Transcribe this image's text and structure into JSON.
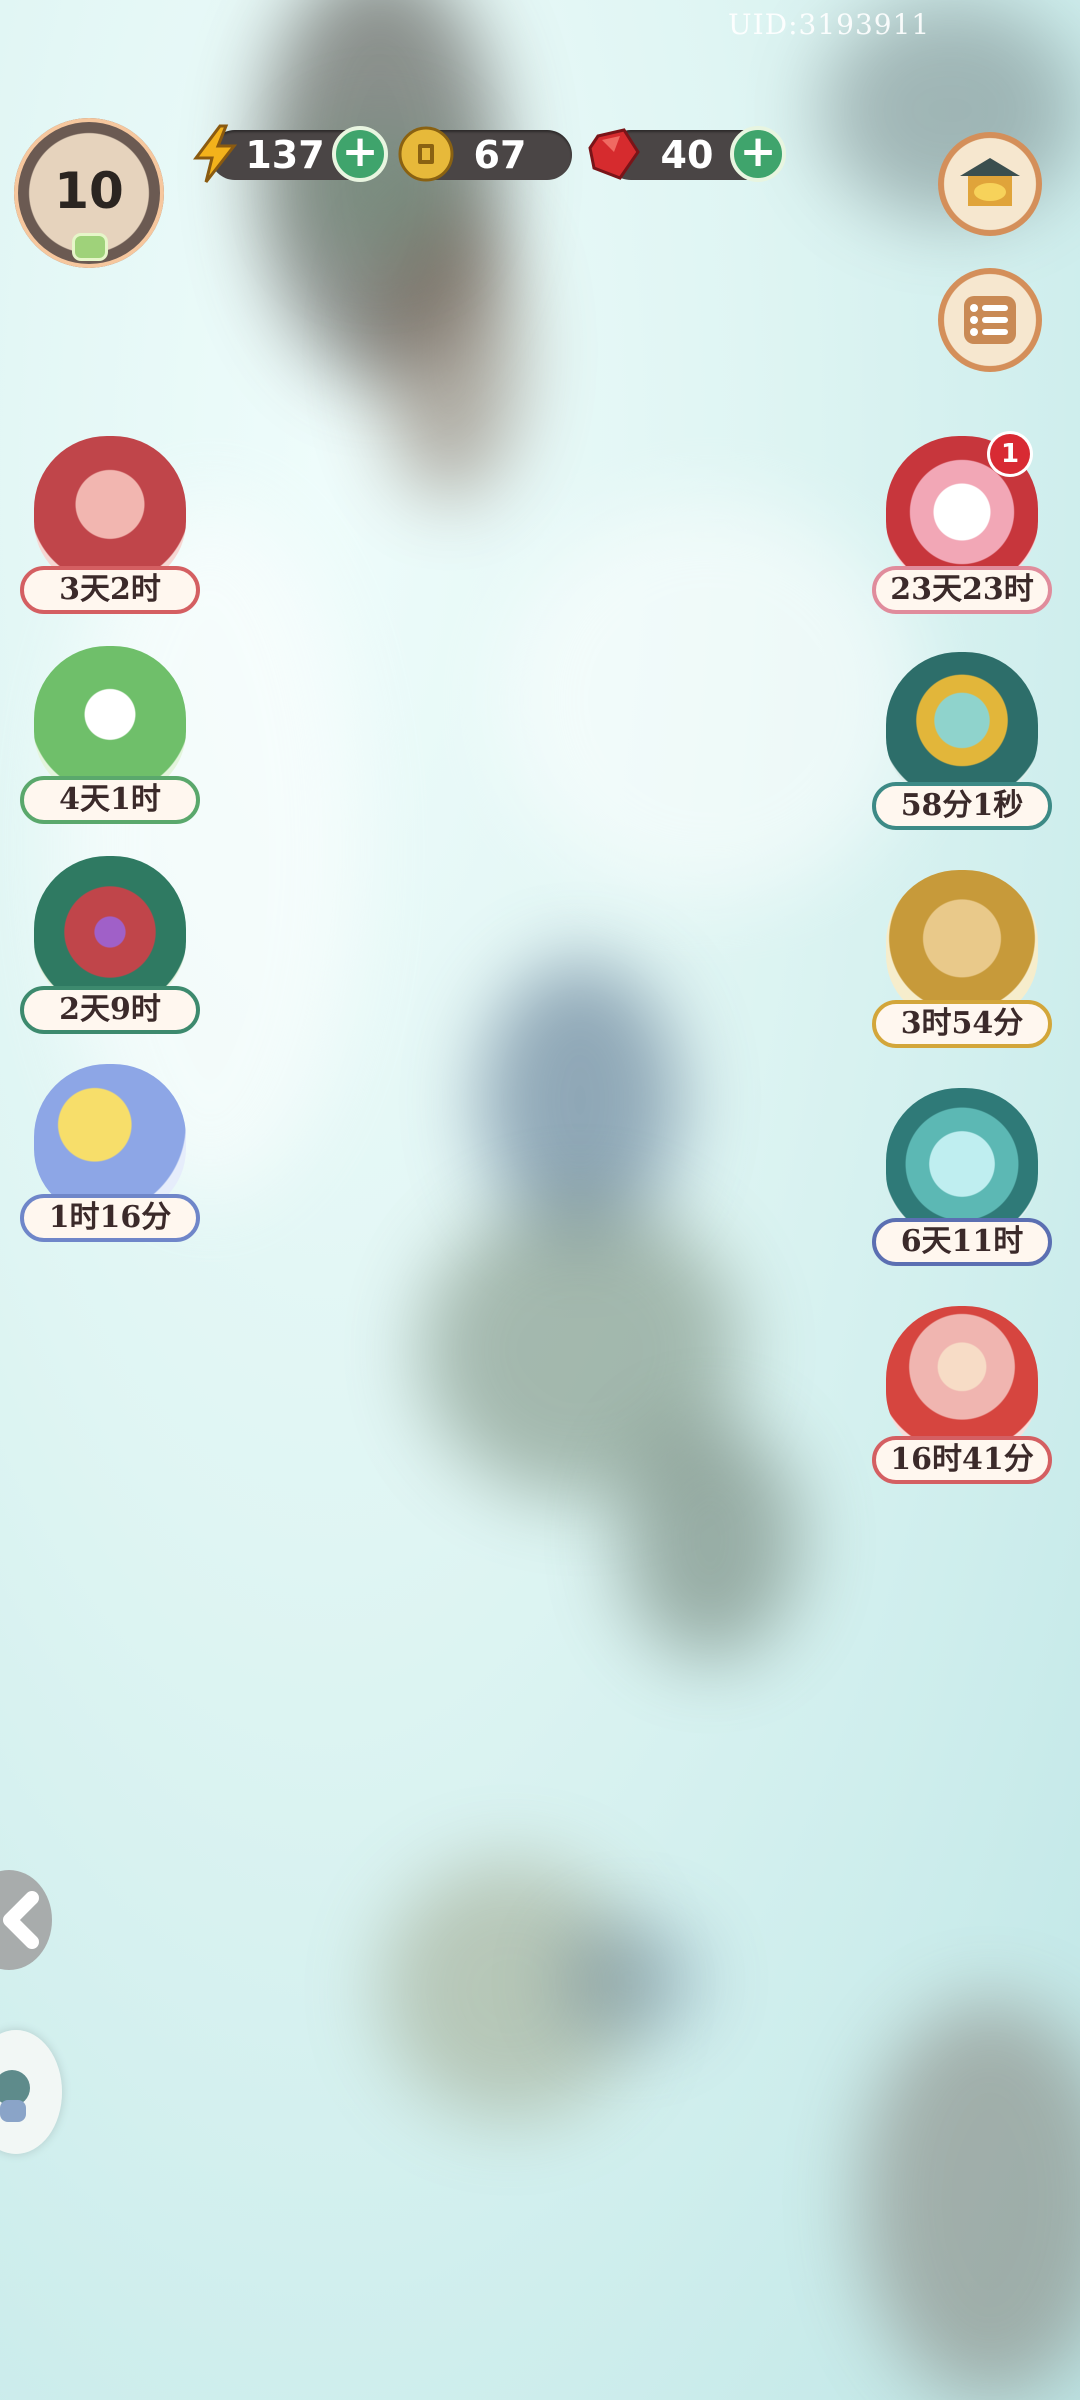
{
  "uid": "UID:3193911",
  "level": "10",
  "resources": {
    "energy": "137",
    "coins": "67",
    "gems": "40"
  },
  "colors": {
    "energy": "#f3b21b",
    "coin": "#d9a72a",
    "gem": "#d62b2e",
    "plus": "#3fa46c",
    "pill": "#4a4545"
  },
  "top_right_buttons": [
    "shop-icon",
    "menu-list-icon"
  ],
  "left_events": [
    {
      "label": "3天2时",
      "icon": "scroll-book-icon",
      "border": "#d45f62"
    },
    {
      "label": "4天1时",
      "icon": "owl-bird-icon",
      "border": "#5aa86c"
    },
    {
      "label": "2天9时",
      "icon": "temple-coins-icon",
      "border": "#3d8a6e"
    },
    {
      "label": "1时16分",
      "icon": "moon-rabbit-icon",
      "border": "#6f86c9"
    }
  ],
  "right_events": [
    {
      "label": "23天23时",
      "icon": "white-rabbit-icon",
      "border": "#e08c9c",
      "badge": "1"
    },
    {
      "label": "58分1秒",
      "icon": "cat-coin-cart-icon",
      "border": "#3d8a86"
    },
    {
      "label": "3时54分",
      "icon": "golden-box-icon",
      "border": "#d3a63a"
    },
    {
      "label": "6天11时",
      "icon": "cat-gift-box-icon",
      "border": "#5b6fb2"
    },
    {
      "label": "16时41分",
      "icon": "girl-merchant-icon",
      "border": "#d45f62"
    }
  ]
}
